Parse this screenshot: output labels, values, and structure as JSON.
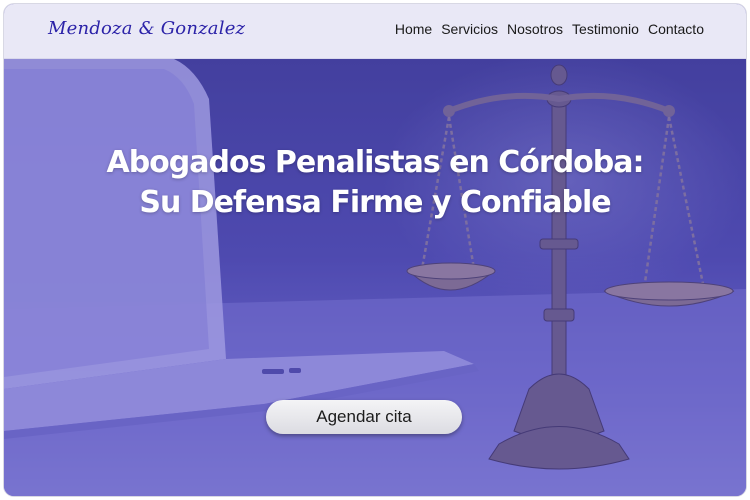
{
  "brand": {
    "name": "Mendoza & Gonzalez"
  },
  "nav": {
    "items": [
      "Home",
      "Servicios",
      "Nosotros",
      "Testimonio",
      "Contacto"
    ]
  },
  "hero": {
    "headline_line1": "Abogados Penalistas en Córdoba:",
    "headline_line2": "Su Defensa Firme y Confiable",
    "cta_label": "Agendar cita",
    "background_image": "scales-of-justice-with-laptop"
  },
  "colors": {
    "brand_text": "#2b22a8",
    "navbar_bg": "#e9e8f6",
    "hero_overlay": "#5850c8",
    "headline": "#ffffff",
    "cta_bg": "#e8e8ec"
  }
}
